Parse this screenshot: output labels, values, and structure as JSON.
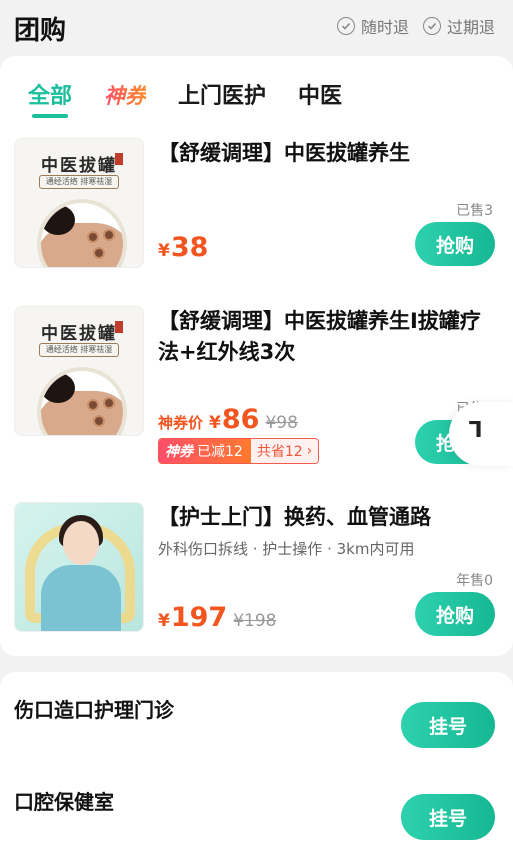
{
  "header": {
    "title": "团购",
    "guarantees": [
      "随时退",
      "过期退"
    ]
  },
  "tabs": [
    "全部",
    "神券",
    "上门医护",
    "中医"
  ],
  "products": [
    {
      "title": "【舒缓调理】中医拔罐养生",
      "thumb_title": "中医拔罐",
      "thumb_subtitle": "通经活络 排寒祛湿",
      "sold": "已售3",
      "price_symbol": "¥",
      "price": "38",
      "button": "抢购"
    },
    {
      "title": "【舒缓调理】中医拔罐养生I拔罐疗法+红外线3次",
      "thumb_title": "中医拔罐",
      "thumb_subtitle": "通经活络 排寒祛湿",
      "sold": "已售0",
      "price_prefix": "神券价",
      "price_symbol": "¥",
      "price": "86",
      "original_price": "¥98",
      "coupon_brand": "神券",
      "coupon_reduced": "已减12",
      "coupon_saved": "共省12",
      "button": "抢购"
    },
    {
      "title": "【护士上门】换药、血管通路",
      "description": "外科伤口拆线 · 护士操作 · 3km内可用",
      "sold": "年售0",
      "price_symbol": "¥",
      "price": "197",
      "original_price": "¥198",
      "button": "抢购"
    }
  ],
  "floating": {
    "glyph": "⅂"
  },
  "clinics": [
    {
      "name": "伤口造口护理门诊",
      "button": "挂号"
    },
    {
      "name": "口腔保健室",
      "button": "挂号"
    }
  ],
  "colors": {
    "accent": "#1bbf9c",
    "price": "#f2551f"
  }
}
